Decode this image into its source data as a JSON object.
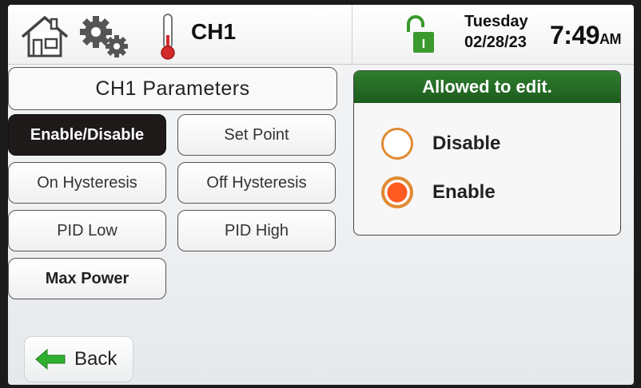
{
  "header": {
    "title": "CH1",
    "day": "Tuesday",
    "date": "02/28/23",
    "time": "7:49",
    "ampm": "AM",
    "icons": [
      "home-icon",
      "settings-gear-icon",
      "thermometer-icon",
      "unlocked-padlock-icon"
    ]
  },
  "panel": {
    "title": "CH1 Parameters",
    "buttons": [
      {
        "label": "Enable/Disable"
      },
      {
        "label": "Set Point"
      },
      {
        "label": "On Hysteresis"
      },
      {
        "label": "Off Hysteresis"
      },
      {
        "label": "PID Low"
      },
      {
        "label": "PID High"
      },
      {
        "label": "Max Power"
      }
    ]
  },
  "edit": {
    "header": "Allowed to edit.",
    "options": [
      {
        "label": "Disable",
        "selected": false
      },
      {
        "label": "Enable",
        "selected": true
      }
    ]
  },
  "back": {
    "label": "Back"
  },
  "colors": {
    "accent_green": "#1d5c1d",
    "radio_orange": "#e08a33",
    "radio_selected": "#ff5a1f",
    "active_button": "#1e1a1a",
    "lock_green": "#3a9a2e"
  }
}
